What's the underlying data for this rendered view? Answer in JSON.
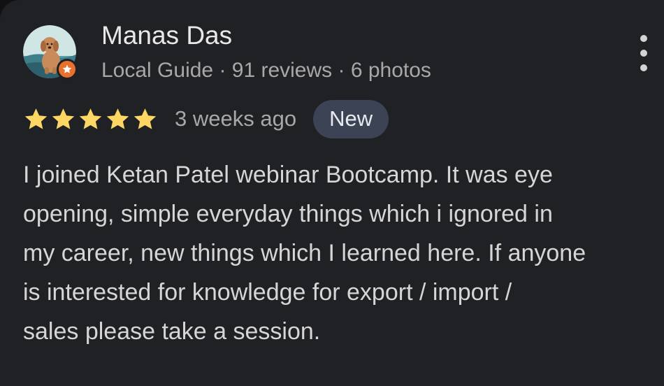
{
  "review": {
    "reviewer": {
      "name": "Manas Das",
      "meta": "Local Guide · 91 reviews · 6 photos",
      "avatar_icon": "dog-illustration-avatar",
      "badge_icon": "local-guide-star-icon",
      "badge_color": "#e8712d"
    },
    "rating": {
      "stars": 5,
      "max": 5,
      "star_color": "#fdd663",
      "time": "3 weeks ago",
      "badge": "New"
    },
    "text": "I joined Ketan Patel webinar Bootcamp. It was eye\nopening, simple everyday things which i ignored in\nmy career, new things which I learned here. If anyone\nis interested for knowledge for export / import /\nsales please take a session.",
    "more_icon": "more-vert-icon"
  },
  "colors": {
    "background": "#202124",
    "badge_bg": "#3c4354"
  }
}
